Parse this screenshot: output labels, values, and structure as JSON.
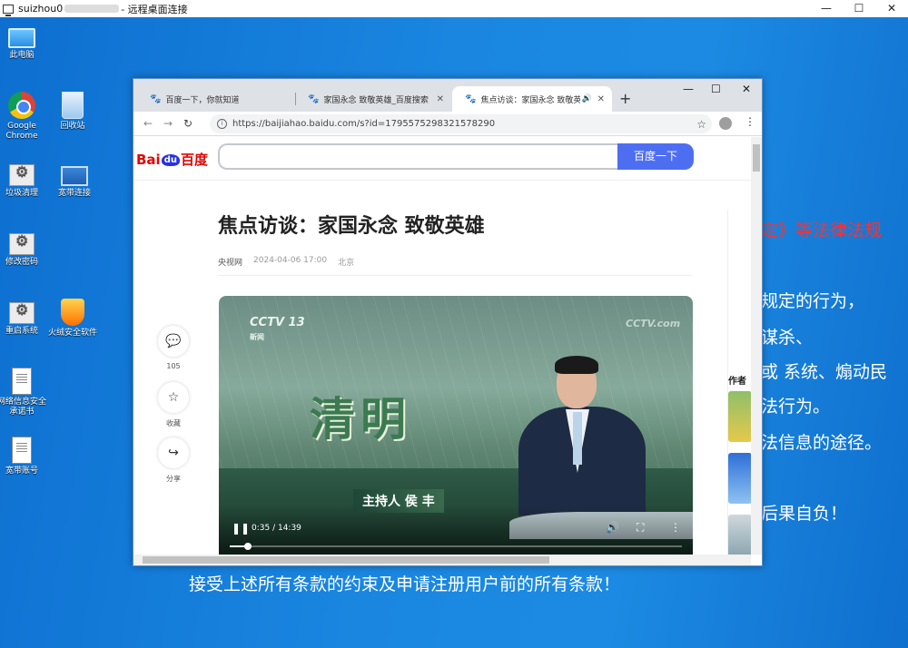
{
  "rdp": {
    "host": "suizhou0",
    "title_suffix": "- 远程桌面连接",
    "min": "—",
    "max": "☐",
    "close": "✕"
  },
  "desktop": {
    "icons": [
      {
        "label": "此电脑",
        "icon": "computer-icon"
      },
      {
        "label": "Google Chrome",
        "icon": "chrome-icon"
      },
      {
        "label": "回收站",
        "icon": "recycle-bin-icon"
      },
      {
        "label": "垃圾清理",
        "icon": "gear-shortcut-icon"
      },
      {
        "label": "宽带连接",
        "icon": "network-icon"
      },
      {
        "label": "修改密码",
        "icon": "gear-shortcut-icon"
      },
      {
        "label": "重启系统",
        "icon": "gear-shortcut-icon"
      },
      {
        "label": "火绒安全软件",
        "icon": "huorong-icon"
      },
      {
        "label": "网络信息安全承诺书",
        "icon": "document-icon"
      },
      {
        "label": "宽带账号",
        "icon": "document-icon"
      }
    ],
    "wallpaper_lines": [
      "定》等法律法规",
      "规定的行为，",
      "谋杀、",
      "或  系统、煽动民",
      "法行为。",
      "法信息的途径。",
      "后果自负！",
      "接受上述所有条款的约束及申请注册用户前的所有条款！"
    ]
  },
  "browser": {
    "tabs": [
      {
        "title": "百度一下，你就知道",
        "active": false
      },
      {
        "title": "家国永念 致敬英雄_百度搜索",
        "active": false
      },
      {
        "title": "焦点访谈：家国永念 致敬英雄",
        "active": true
      }
    ],
    "window_controls": {
      "min": "—",
      "max": "☐",
      "close": "✕"
    },
    "url": "https://baijiahao.baidu.com/s?id=1795575298321578290",
    "search_button": "百度一下",
    "logo": {
      "bai": "Bai",
      "du": "du",
      "cn": "百度"
    },
    "article": {
      "title": "焦点访谈：家国永念 致敬英雄",
      "source": "央视网",
      "datetime": "2024-04-06 17:00",
      "location": "北京"
    },
    "actions": [
      {
        "icon": "comment-icon",
        "glyph": "💬",
        "label": "105"
      },
      {
        "icon": "star-icon",
        "glyph": "☆",
        "label": "收藏"
      },
      {
        "icon": "share-icon",
        "glyph": "↪",
        "label": "分享"
      }
    ],
    "video": {
      "channel": "CCTV 13",
      "channel_sub": "新闻",
      "watermark": "CCTV.com",
      "program_text": "清明",
      "caption": "主持人  侯  丰",
      "time": "0:35 / 14:39",
      "progress": 0.04
    },
    "sidebar": {
      "author_title": "作者"
    }
  }
}
